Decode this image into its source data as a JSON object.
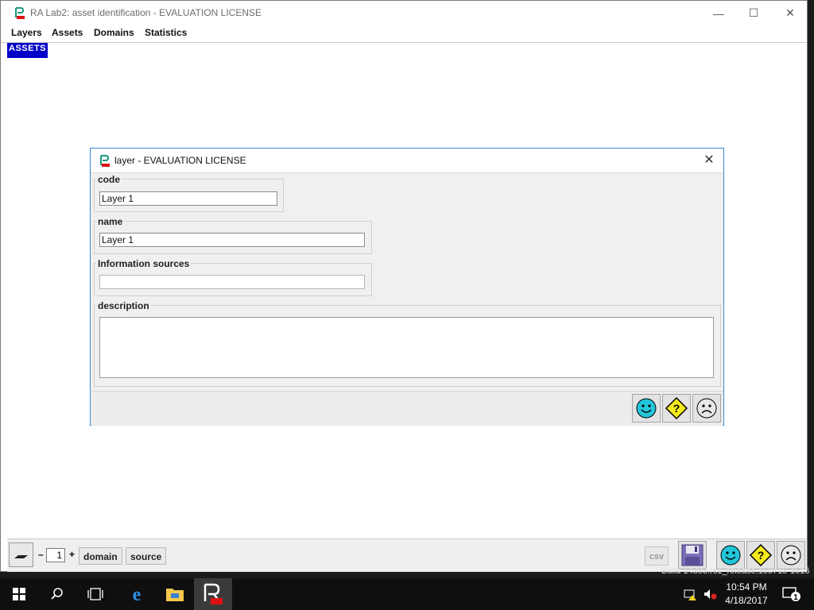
{
  "window": {
    "title": "RA Lab2: asset identification - EVALUATION LICENSE",
    "minimize": "—",
    "maximize": "☐",
    "close": "✕"
  },
  "menu": [
    "Layers",
    "Assets",
    "Domains",
    "Statistics"
  ],
  "canvas": {
    "assets_label": "ASSETS"
  },
  "dialog": {
    "title": "layer - EVALUATION LICENSE",
    "close": "✕",
    "code": {
      "legend": "code",
      "value": "Layer 1"
    },
    "name": {
      "legend": "name",
      "value": "Layer 1"
    },
    "info_sources": {
      "legend": "Information sources",
      "value": ""
    },
    "description": {
      "legend": "description",
      "value": ""
    },
    "buttons": [
      "ok-smiley-icon",
      "help-question-icon",
      "cancel-frown-icon"
    ]
  },
  "bottom_toolbar": {
    "stepper_minus": "–",
    "stepper_value": "1",
    "stepper_plus": "+",
    "domain_label": "domain",
    "source_label": "source",
    "csv_label": "csv"
  },
  "build_text": "Build 14393.rs1_release.160715-1616",
  "taskbar": {
    "time": "10:54 PM",
    "date": "4/18/2017",
    "notification_count": "1"
  },
  "colors": {
    "assets_bg": "#0000c8",
    "smiley": "#22c6d8",
    "question": "#f5ea1c",
    "dialog_border": "#3b86d6"
  }
}
